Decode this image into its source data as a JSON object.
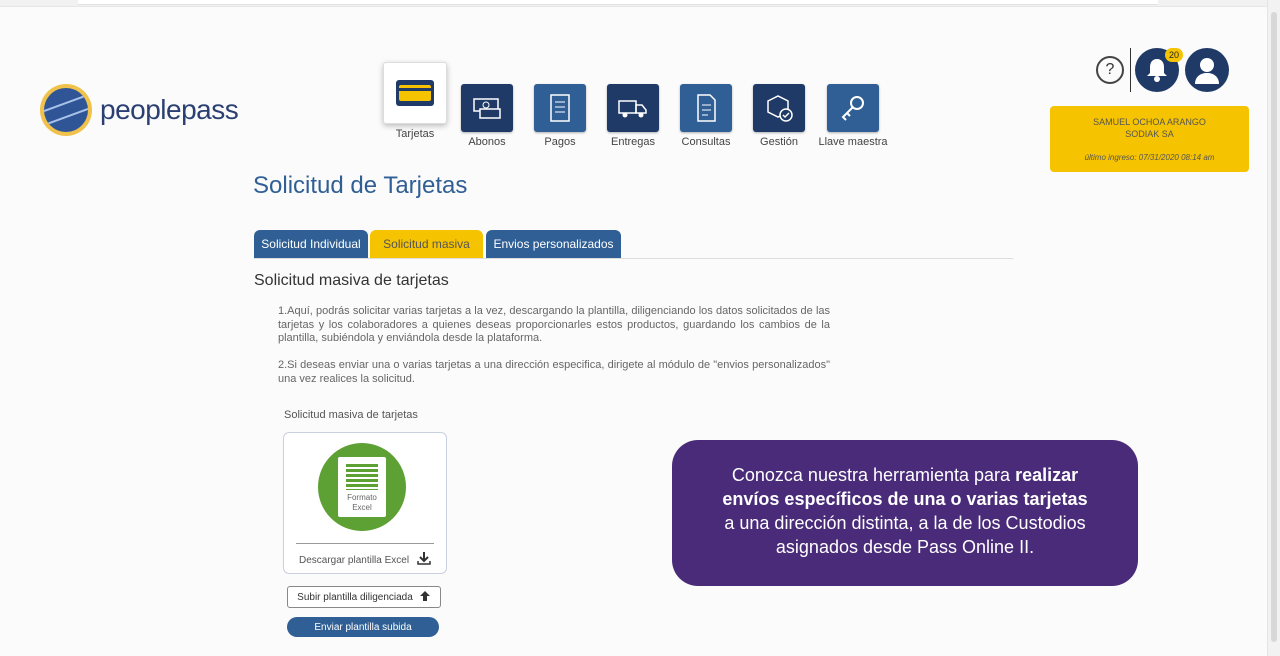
{
  "brand": {
    "name": "peoplepass"
  },
  "nav": [
    {
      "label": "Tarjetas",
      "icon": "card-icon",
      "color": "#ffffff",
      "active": true
    },
    {
      "label": "Abonos",
      "icon": "money-icon",
      "color": "#1f3a66"
    },
    {
      "label": "Pagos",
      "icon": "receipt-icon",
      "color": "#2f5f94"
    },
    {
      "label": "Entregas",
      "icon": "truck-icon",
      "color": "#1f3a66"
    },
    {
      "label": "Consultas",
      "icon": "document-icon",
      "color": "#2f5f94"
    },
    {
      "label": "Gestión",
      "icon": "box-check-icon",
      "color": "#1f3a66"
    },
    {
      "label": "Llave maestra",
      "icon": "key-icon",
      "color": "#2f5f94"
    }
  ],
  "header": {
    "help_symbol": "?",
    "notification_count": "20",
    "user_name": "SAMUEL OCHOA ARANGO",
    "company": "SODIAK SA",
    "last_login": "último ingreso: 07/31/2020 08:14 am"
  },
  "page": {
    "title": "Solicitud de Tarjetas"
  },
  "tabs": [
    {
      "label": "Solicitud Individual",
      "state": "inactive"
    },
    {
      "label": "Solicitud masiva",
      "state": "active"
    },
    {
      "label": "Envios personalizados",
      "state": "inactive"
    }
  ],
  "section": {
    "title": "Solicitud masiva de tarjetas",
    "para1": "1.Aquí, podrás solicitar varias tarjetas a la vez, descargando la plantilla, diligenciando los datos solicitados de las tarjetas y los colaboradores a quienes deseas proporcionarles estos productos, guardando los cambios de la plantilla, subiéndola y enviándola desde la plataforma.",
    "para2": "2.Si deseas enviar una o varias tarjetas a una dirección especifica, dirigete al módulo de \"envios personalizados\" una vez realices la solicitud."
  },
  "download_card": {
    "caption": "Solicitud masiva de tarjetas",
    "format_line1": "Formato",
    "format_line2": "Excel",
    "download_label": "Descargar plantilla Excel",
    "download_icon": "download-icon"
  },
  "buttons": {
    "upload": "Subir plantilla diligenciada",
    "upload_icon": "arrow-up-icon",
    "send": "Enviar plantilla subida"
  },
  "promo": {
    "line1_normal": "Conozca nuestra herramienta para ",
    "line1_bold": "realizar",
    "line2_bold": "envíos específicos de una o varias tarjetas",
    "line3": "a una dirección distinta, a la de los Custodios",
    "line4": "asignados desde Pass Online II."
  },
  "colors": {
    "primary": "#2f5f94",
    "dark": "#1f3a66",
    "accent": "#f5c300",
    "promo": "#4a2b7a",
    "excel": "#5da033"
  }
}
